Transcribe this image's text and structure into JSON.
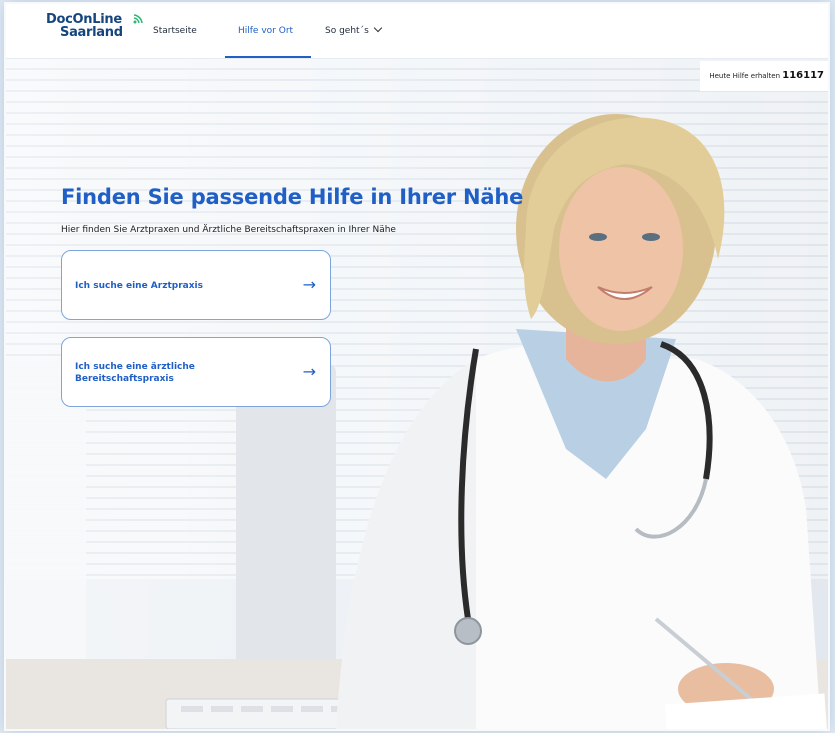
{
  "header": {
    "logo_line1": "DocOnLine",
    "logo_line2": "Saarland",
    "nav": [
      {
        "label": "Startseite"
      },
      {
        "label": "Hilfe vor Ort"
      },
      {
        "label": "So geht´s"
      }
    ],
    "hotline_label": "Heute Hilfe erhalten",
    "hotline_number": "116117"
  },
  "hero": {
    "title": "Finden Sie passende Hilfe in Ihrer Nähe",
    "subtitle": "Hier finden Sie Arztpraxen und Ärztliche Bereitschaftspraxen in Ihrer Nähe",
    "cards": [
      {
        "label": "Ich suche eine Arztpraxis",
        "arrow": "→"
      },
      {
        "label": "Ich suche eine ärztliche Bereitschaftspraxis",
        "arrow": "→"
      }
    ]
  },
  "colors": {
    "accent": "#1f5fc6",
    "logo": "#16457e",
    "logo_signal": "#2bb673"
  },
  "icons": {
    "nav_dropdown": "chevron-down-icon",
    "card_arrow": "arrow-right-icon",
    "logo_signal": "signal-icon"
  }
}
